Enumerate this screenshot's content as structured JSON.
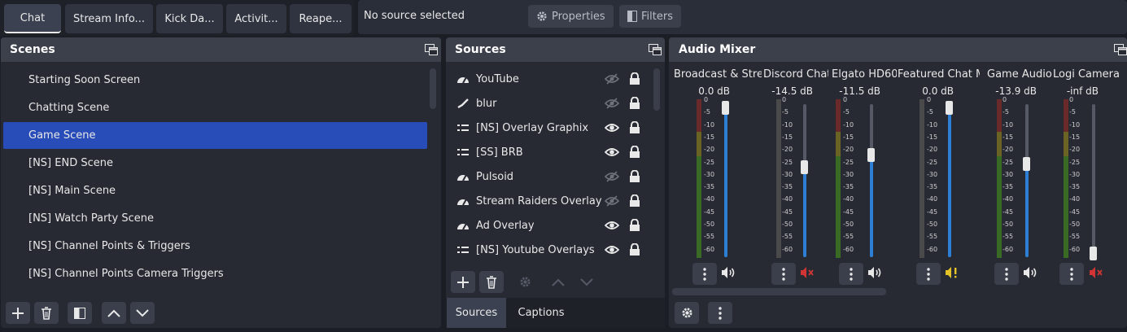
{
  "tabs": [
    {
      "label": "Chat",
      "active": true
    },
    {
      "label": "Stream Info..."
    },
    {
      "label": "Kick Da..."
    },
    {
      "label": "Activit..."
    },
    {
      "label": "Reape..."
    }
  ],
  "source_bar": {
    "status": "No source selected",
    "properties_label": "Properties",
    "filters_label": "Filters"
  },
  "scenes": {
    "title": "Scenes",
    "items": [
      "Starting Soon Screen",
      "Chatting Scene",
      "Game Scene",
      "[NS] END Scene",
      "[NS] Main Scene",
      "[NS] Watch Party Scene",
      "[NS] Channel Points & Triggers",
      "[NS] Channel Points Camera Triggers"
    ],
    "selected_index": 2
  },
  "sources": {
    "title": "Sources",
    "items": [
      {
        "name": "YouTube",
        "icon": "browser-icon",
        "visible": false
      },
      {
        "name": "blur",
        "icon": "brush-icon",
        "visible": false
      },
      {
        "name": "[NS] Overlay Graphix",
        "icon": "group-icon",
        "visible": true
      },
      {
        "name": "[SS] BRB",
        "icon": "group-icon",
        "visible": true
      },
      {
        "name": "Pulsoid",
        "icon": "browser-icon",
        "visible": false
      },
      {
        "name": "Stream Raiders Overlay",
        "icon": "browser-icon",
        "visible": false
      },
      {
        "name": "Ad Overlay",
        "icon": "browser-icon",
        "visible": true
      },
      {
        "name": "[NS] Youtube Overlays",
        "icon": "group-icon",
        "visible": true
      }
    ],
    "bottom_tabs": [
      "Sources",
      "Captions"
    ]
  },
  "mixer": {
    "title": "Audio Mixer",
    "scale": [
      "0",
      "-5",
      "-10",
      "-15",
      "-20",
      "-25",
      "-30",
      "-35",
      "-40",
      "-45",
      "-50",
      "-55",
      "-60"
    ],
    "channels": [
      {
        "name": "Broadcast & Strea",
        "db": "0.0 dB",
        "level": 1.0,
        "muted": false,
        "status": "volume-icon"
      },
      {
        "name": "Discord Chat",
        "db": "-14.5 dB",
        "level": 0.59,
        "muted": true,
        "status": "muted-icon"
      },
      {
        "name": "Elgato HD60",
        "db": "-11.5 dB",
        "level": 0.67,
        "muted": false,
        "status": "volume-icon"
      },
      {
        "name": "Featured Chat Me",
        "db": "0.0 dB",
        "level": 1.0,
        "muted": false,
        "status": "warning-icon"
      },
      {
        "name": "Game Audio",
        "db": "-13.9 dB",
        "level": 0.61,
        "muted": false,
        "status": "volume-icon"
      },
      {
        "name": "Logi Camera",
        "db": "-inf dB",
        "level": 0.0,
        "muted": true,
        "status": "muted-icon"
      }
    ]
  },
  "colors": {
    "selection": "#284cb8",
    "fader": "#2d7fd6",
    "muted": "#d13434",
    "warning": "#e6c229"
  }
}
